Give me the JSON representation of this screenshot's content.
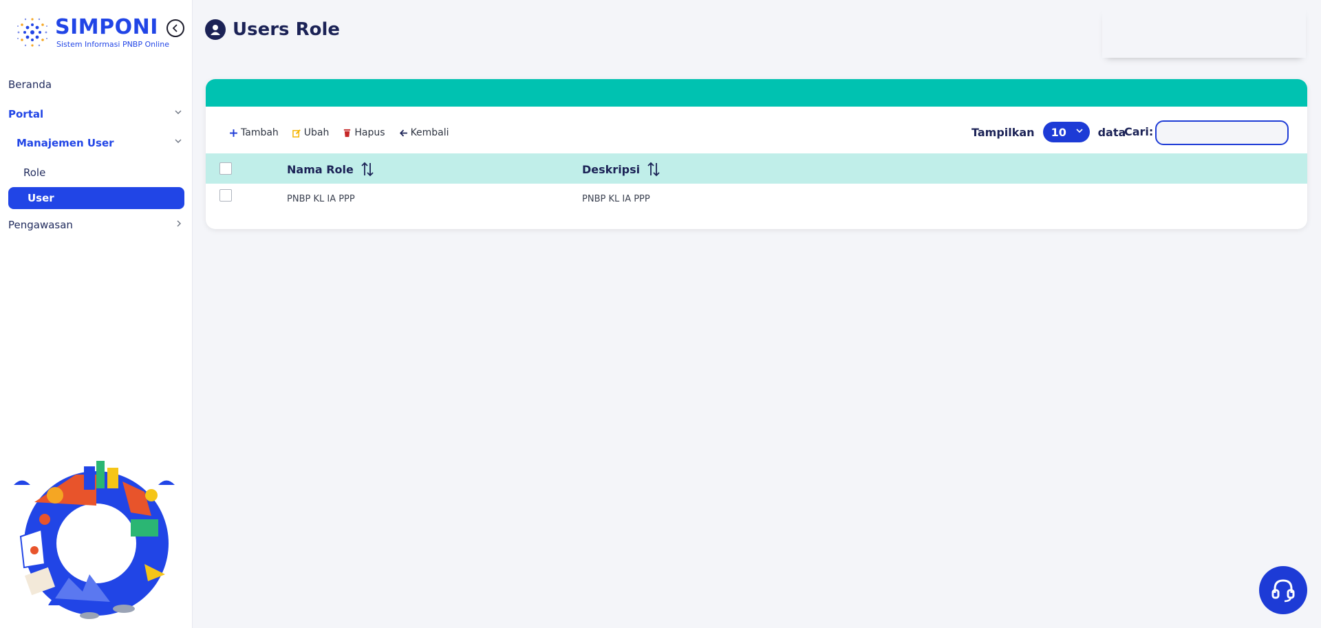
{
  "app": {
    "logo_title": "SIMPONI",
    "logo_subtitle": "Sistem Informasi PNBP Online",
    "brand_color": "#2145e6"
  },
  "sidebar": {
    "items": [
      {
        "label": "Beranda"
      },
      {
        "label": "Portal"
      },
      {
        "label": "Manajemen User"
      },
      {
        "label": "Role"
      },
      {
        "label": "User"
      },
      {
        "label": "Pengawasan"
      }
    ]
  },
  "page": {
    "title": "Users Role",
    "header_color": "#00c2b1"
  },
  "toolbar": {
    "add_label": "Tambah",
    "edit_label": "Ubah",
    "delete_label": "Hapus",
    "back_label": "Kembali"
  },
  "list_controls": {
    "show_label": "Tampilkan",
    "page_size": "10",
    "data_label": "data",
    "search_label": "Cari:",
    "search_value": ""
  },
  "table": {
    "columns": [
      "Nama Role",
      "Deskripsi"
    ],
    "rows": [
      {
        "nama_role": "PNBP KL IA PPP",
        "deskripsi": "PNBP KL IA PPP"
      }
    ]
  }
}
